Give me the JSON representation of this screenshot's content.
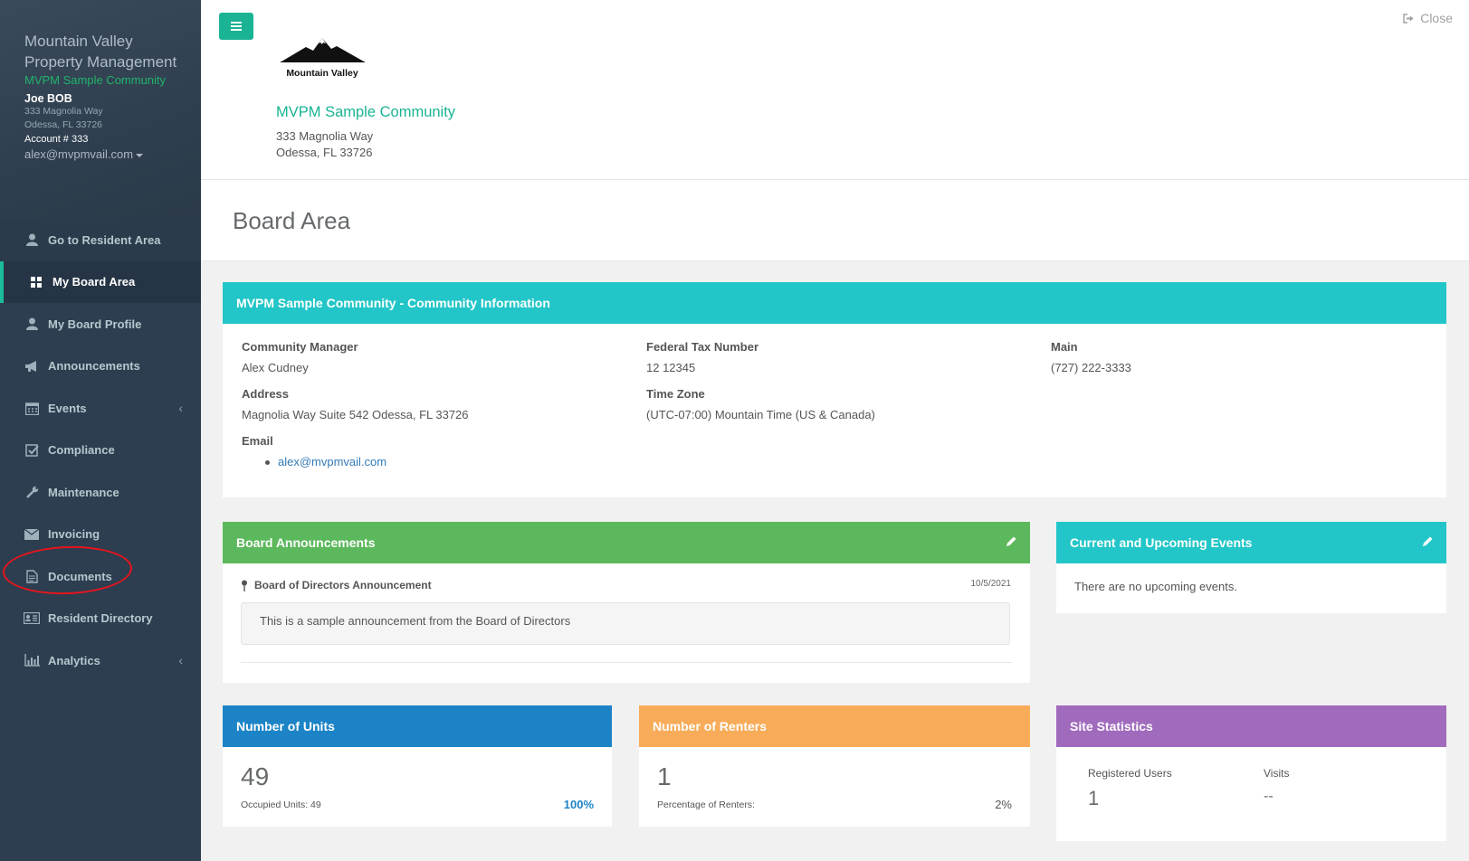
{
  "sidebar": {
    "brand_title": "Mountain Valley Property Management",
    "community": "MVPM Sample Community",
    "user_name": "Joe BOB",
    "address1": "333 Magnolia Way",
    "address2": "Odessa, FL 33726",
    "account": "Account # 333",
    "email": "alex@mvpmvail.com",
    "items": [
      {
        "label": "Go to Resident Area",
        "icon": "user-icon"
      },
      {
        "label": "My Board Area",
        "icon": "grid-icon"
      },
      {
        "label": "My Board Profile",
        "icon": "user-icon"
      },
      {
        "label": "Announcements",
        "icon": "megaphone-icon"
      },
      {
        "label": "Events",
        "icon": "calendar-icon"
      },
      {
        "label": "Compliance",
        "icon": "checkbox-icon"
      },
      {
        "label": "Maintenance",
        "icon": "wrench-icon"
      },
      {
        "label": "Invoicing",
        "icon": "envelope-icon"
      },
      {
        "label": "Documents",
        "icon": "document-icon"
      },
      {
        "label": "Resident Directory",
        "icon": "id-card-icon"
      },
      {
        "label": "Analytics",
        "icon": "bar-chart-icon"
      }
    ]
  },
  "topbar": {
    "close_label": "Close",
    "logo_text": "Mountain Valley",
    "community_name": "MVPM Sample Community",
    "address1": "333 Magnolia Way",
    "address2": "Odessa, FL 33726"
  },
  "page_title": "Board Area",
  "info_panel": {
    "title": "MVPM Sample Community - Community Information",
    "manager_label": "Community Manager",
    "manager_value": "Alex Cudney",
    "address_label": "Address",
    "address_value": "Magnolia Way Suite 542 Odessa, FL 33726",
    "email_label": "Email",
    "email_value": "alex@mvpmvail.com",
    "tax_label": "Federal Tax Number",
    "tax_value": "12 12345",
    "tz_label": "Time Zone",
    "tz_value": "(UTC-07:00) Mountain Time (US & Canada)",
    "main_label": "Main",
    "main_value": "(727) 222-3333"
  },
  "announcements": {
    "title": "Board Announcements",
    "item_title": "Board of Directors Announcement",
    "item_date": "10/5/2021",
    "item_body": "This is a sample announcement from the Board of Directors"
  },
  "events": {
    "title": "Current and Upcoming Events",
    "empty": "There are no upcoming events."
  },
  "units": {
    "title": "Number of Units",
    "value": "49",
    "label": "Occupied Units: 49",
    "pct": "100%"
  },
  "renters": {
    "title": "Number of Renters",
    "value": "1",
    "label": "Percentage of Renters:",
    "pct": "2%"
  },
  "stats": {
    "title": "Site Statistics",
    "users_label": "Registered Users",
    "users_value": "1",
    "visits_label": "Visits",
    "visits_value": "--"
  },
  "colors": {
    "accent": "#1ab394",
    "sidebar": "#2c3e50",
    "teal": "#23c6c8",
    "green": "#5cb85c",
    "blue": "#1c84c6",
    "orange": "#f8ac59",
    "purple": "#a06bbd"
  }
}
